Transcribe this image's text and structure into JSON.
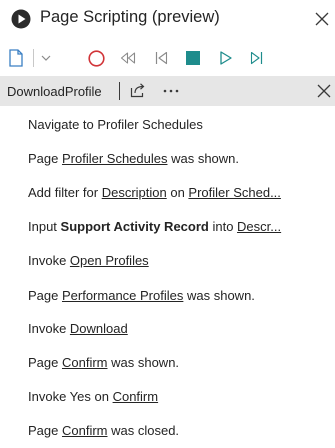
{
  "window": {
    "title": "Page Scripting (preview)",
    "play_icon": "play-circle-icon",
    "close_icon": "close-icon"
  },
  "toolbar": {
    "buttons": [
      {
        "name": "new-file-button",
        "icon": "new-file-icon"
      },
      {
        "name": "new-dropdown-button",
        "icon": "chevron-down-icon"
      },
      {
        "name": "record-button",
        "icon": "record-icon"
      },
      {
        "name": "rewind-button",
        "icon": "rewind-icon"
      },
      {
        "name": "step-back-button",
        "icon": "step-back-icon"
      },
      {
        "name": "stop-button",
        "icon": "stop-icon"
      },
      {
        "name": "play-button",
        "icon": "play-icon"
      },
      {
        "name": "step-forward-button",
        "icon": "step-forward-icon"
      }
    ],
    "colors": {
      "record": "#d13438",
      "stop": "#1e8c8c",
      "play": "#1e8c8c",
      "disabled": "#8a8a8a"
    }
  },
  "recording": {
    "name": "DownloadProfile",
    "share_icon": "share-icon",
    "more_icon": "more-icon",
    "close_icon": "close-icon",
    "background": "#e6e6e6"
  },
  "steps": [
    {
      "parts": [
        {
          "t": "Navigate to Profiler Schedules",
          "s": "plain"
        }
      ]
    },
    {
      "parts": [
        {
          "t": "Page ",
          "s": "plain"
        },
        {
          "t": "Profiler Schedules",
          "s": "link"
        },
        {
          "t": " was shown.",
          "s": "plain"
        }
      ]
    },
    {
      "parts": [
        {
          "t": "Add filter for ",
          "s": "plain"
        },
        {
          "t": "Description",
          "s": "link"
        },
        {
          "t": " on ",
          "s": "plain"
        },
        {
          "t": "Profiler Sched...",
          "s": "link"
        }
      ]
    },
    {
      "parts": [
        {
          "t": "Input ",
          "s": "plain"
        },
        {
          "t": "Support Activity Record",
          "s": "bold"
        },
        {
          "t": " into ",
          "s": "plain"
        },
        {
          "t": "Descr...",
          "s": "link"
        }
      ]
    },
    {
      "parts": [
        {
          "t": "Invoke ",
          "s": "plain"
        },
        {
          "t": "Open Profiles",
          "s": "link"
        }
      ]
    },
    {
      "parts": [
        {
          "t": "Page ",
          "s": "plain"
        },
        {
          "t": "Performance Profiles",
          "s": "link"
        },
        {
          "t": " was shown.",
          "s": "plain"
        }
      ]
    },
    {
      "parts": [
        {
          "t": "Invoke ",
          "s": "plain"
        },
        {
          "t": "Download",
          "s": "link"
        }
      ]
    },
    {
      "parts": [
        {
          "t": "Page ",
          "s": "plain"
        },
        {
          "t": "Confirm",
          "s": "link"
        },
        {
          "t": " was shown.",
          "s": "plain"
        }
      ]
    },
    {
      "parts": [
        {
          "t": "Invoke Yes on ",
          "s": "plain"
        },
        {
          "t": "Confirm",
          "s": "link"
        }
      ]
    },
    {
      "parts": [
        {
          "t": "Page ",
          "s": "plain"
        },
        {
          "t": "Confirm",
          "s": "link"
        },
        {
          "t": " was closed.",
          "s": "plain"
        }
      ]
    }
  ]
}
